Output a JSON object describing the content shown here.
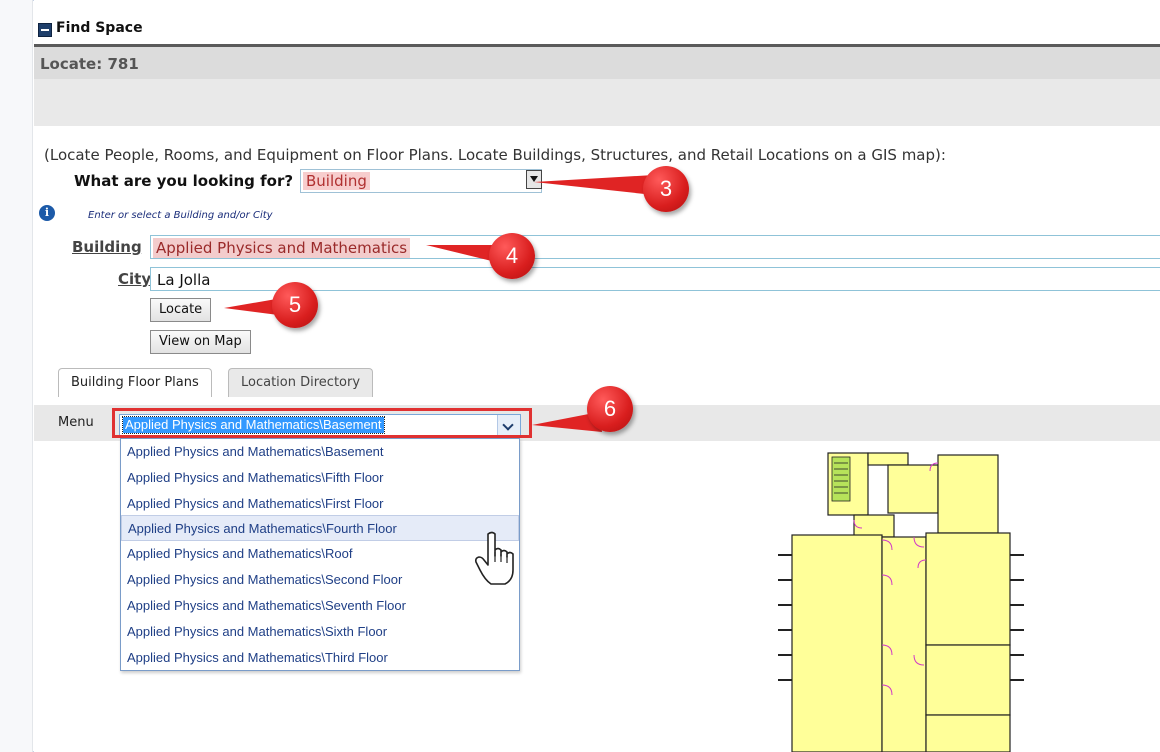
{
  "panel": {
    "title": "Find Space",
    "locate_label": "Locate: 781"
  },
  "form": {
    "intro": "(Locate People, Rooms, and Equipment on Floor Plans. Locate Buildings, Structures, and Retail Locations on a GIS map):",
    "lookfor_label": "What are you looking for?",
    "lookfor_value": "Building",
    "hint": "Enter or select a Building and/or City",
    "building_label": "Building",
    "building_value": "Applied Physics and Mathematics",
    "city_label": "City",
    "city_value": "La Jolla",
    "locate_button": "Locate",
    "view_map_button": "View on Map"
  },
  "tabs": [
    {
      "label": "Building Floor Plans",
      "active": true
    },
    {
      "label": "Location Directory",
      "active": false
    }
  ],
  "menu": {
    "label": "Menu",
    "selected": "Applied Physics and Mathematics\\Basement",
    "options": [
      "Applied Physics and Mathematics\\Basement",
      "Applied Physics and Mathematics\\Fifth Floor",
      "Applied Physics and Mathematics\\First Floor",
      "Applied Physics and Mathematics\\Fourth Floor",
      "Applied Physics and Mathematics\\Roof",
      "Applied Physics and Mathematics\\Second Floor",
      "Applied Physics and Mathematics\\Seventh Floor",
      "Applied Physics and Mathematics\\Sixth Floor",
      "Applied Physics and Mathematics\\Third Floor"
    ],
    "hovered_option": "Applied Physics and Mathematics\\Fourth Floor"
  },
  "callouts": [
    "3",
    "4",
    "5",
    "6"
  ],
  "colors": {
    "callout": "#e02424",
    "highlight": "#f7cdcd",
    "selection": "#3399ff",
    "floorplan_fill": "#ffff99"
  }
}
